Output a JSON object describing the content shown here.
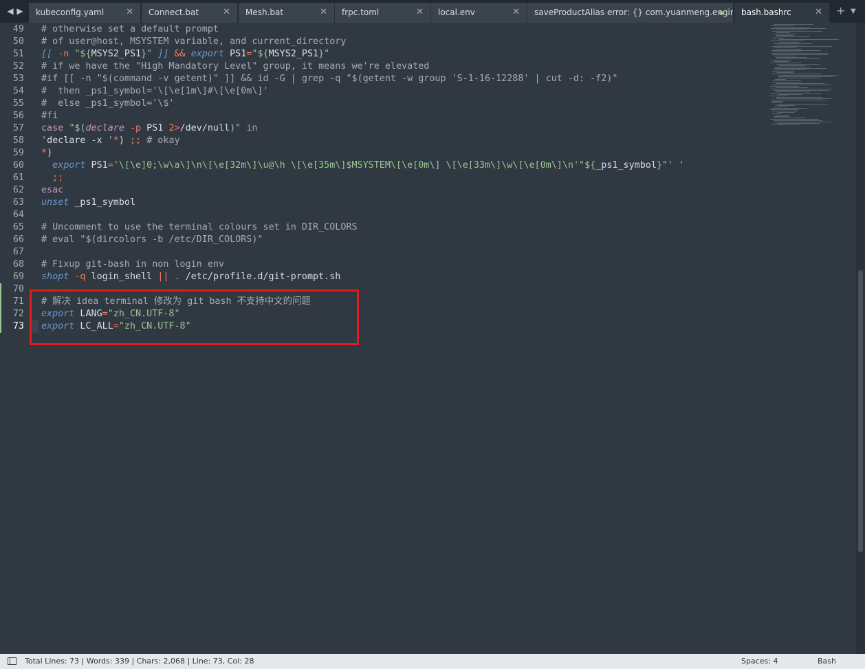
{
  "tabs": [
    {
      "label": "kubeconfig.yaml",
      "active": false
    },
    {
      "label": "Connect.bat",
      "active": false
    },
    {
      "label": "Mesh.bat",
      "active": false
    },
    {
      "label": "frpc.toml",
      "active": false
    },
    {
      "label": "local.env",
      "active": false
    },
    {
      "label": "saveProductAlias error: {} com.yuanmeng.engine.com",
      "active": false,
      "dirty": true
    },
    {
      "label": "bash.bashrc",
      "active": true
    }
  ],
  "icons": {
    "back": "◀",
    "forward": "▶",
    "close": "✕",
    "add": "+",
    "dropdown": "▼"
  },
  "lines": [
    {
      "n": "49",
      "parts": [
        [
          "c",
          "# otherwise set a default prompt"
        ]
      ]
    },
    {
      "n": "50",
      "parts": [
        [
          "c",
          "# of user@host, MSYSTEM variable, and current_directory"
        ]
      ]
    },
    {
      "n": "51",
      "parts": [
        [
          "k",
          "[["
        ],
        [
          "",
          " "
        ],
        [
          "o",
          "-n"
        ],
        [
          "",
          " "
        ],
        [
          "s",
          "\"${"
        ],
        [
          "",
          "MSYS2_PS1"
        ],
        [
          "s",
          "}\""
        ],
        [
          "",
          " "
        ],
        [
          "k",
          "]]"
        ],
        [
          "",
          " "
        ],
        [
          "o",
          "&&"
        ],
        [
          "",
          " "
        ],
        [
          "k",
          "export"
        ],
        [
          "",
          " PS1"
        ],
        [
          "o",
          "="
        ],
        [
          "s",
          "\"${"
        ],
        [
          "",
          "MSYS2_PS1"
        ],
        [
          "s",
          "}\""
        ]
      ]
    },
    {
      "n": "52",
      "parts": [
        [
          "c",
          "# if we have the \"High Mandatory Level\" group, it means we're elevated"
        ]
      ]
    },
    {
      "n": "53",
      "parts": [
        [
          "c",
          "#if [[ -n \"$(command -v getent)\" ]] && id -G | grep -q \"$(getent -w group 'S-1-16-12288' | cut -d: -f2)\""
        ]
      ]
    },
    {
      "n": "54",
      "parts": [
        [
          "c",
          "#  then _ps1_symbol='\\[\\e[1m\\]#\\[\\e[0m\\]'"
        ]
      ]
    },
    {
      "n": "55",
      "parts": [
        [
          "c",
          "#  else _ps1_symbol='\\$'"
        ]
      ]
    },
    {
      "n": "56",
      "parts": [
        [
          "c",
          "#fi"
        ]
      ]
    },
    {
      "n": "57",
      "parts": [
        [
          "kw",
          "case"
        ],
        [
          "",
          " "
        ],
        [
          "s",
          "\"$("
        ],
        [
          "dc",
          "declare"
        ],
        [
          "",
          " "
        ],
        [
          "o",
          "-p"
        ],
        [
          "",
          " PS1 "
        ],
        [
          "o",
          "2>"
        ],
        [
          "",
          "/dev/null"
        ],
        [
          "s",
          ")\""
        ],
        [
          "",
          " "
        ],
        [
          "kw",
          "in"
        ]
      ]
    },
    {
      "n": "58",
      "parts": [
        [
          "s",
          "'"
        ],
        [
          "",
          "declare -x "
        ],
        [
          "s",
          "'"
        ],
        [
          "o",
          "*"
        ],
        [
          "",
          ") "
        ],
        [
          "o",
          ";;"
        ],
        [
          "",
          " "
        ],
        [
          "c",
          "# okay"
        ]
      ]
    },
    {
      "n": "59",
      "parts": [
        [
          "o",
          "*"
        ],
        [
          "",
          ")"
        ]
      ]
    },
    {
      "n": "60",
      "parts": [
        [
          "",
          "  "
        ],
        [
          "k",
          "export"
        ],
        [
          "",
          " PS1"
        ],
        [
          "o",
          "="
        ],
        [
          "s",
          "'\\[\\e]0;\\w\\a\\]\\n\\[\\e[32m\\]\\u@\\h \\[\\e[35m\\]$MSYSTEM\\[\\e[0m\\] \\[\\e[33m\\]\\w\\[\\e[0m\\]\\n'"
        ],
        [
          "s",
          "\"${"
        ],
        [
          "",
          "_ps1_symbol"
        ],
        [
          "s",
          "}\"' '"
        ]
      ]
    },
    {
      "n": "61",
      "parts": [
        [
          "",
          "  "
        ],
        [
          "o",
          ";;"
        ]
      ]
    },
    {
      "n": "62",
      "parts": [
        [
          "kw",
          "esac"
        ]
      ]
    },
    {
      "n": "63",
      "parts": [
        [
          "k",
          "unset"
        ],
        [
          "",
          " _ps1_symbol"
        ]
      ]
    },
    {
      "n": "64",
      "parts": []
    },
    {
      "n": "65",
      "parts": [
        [
          "c",
          "# Uncomment to use the terminal colours set in DIR_COLORS"
        ]
      ]
    },
    {
      "n": "66",
      "parts": [
        [
          "c",
          "# eval \"$(dircolors -b /etc/DIR_COLORS)\""
        ]
      ]
    },
    {
      "n": "67",
      "parts": []
    },
    {
      "n": "68",
      "parts": [
        [
          "c",
          "# Fixup git-bash in non login env"
        ]
      ]
    },
    {
      "n": "69",
      "parts": [
        [
          "k",
          "shopt"
        ],
        [
          "",
          " "
        ],
        [
          "o",
          "-q"
        ],
        [
          "",
          " login_shell "
        ],
        [
          "o",
          "||"
        ],
        [
          "",
          " "
        ],
        [
          "o",
          "."
        ],
        [
          "",
          " /etc/profile.d/git-prompt.sh"
        ]
      ]
    },
    {
      "n": "70",
      "parts": [],
      "modified": true
    },
    {
      "n": "71",
      "parts": [
        [
          "c",
          "# 解决 idea terminal 修改为 git bash 不支持中文的问题"
        ]
      ],
      "modified": true
    },
    {
      "n": "72",
      "parts": [
        [
          "k",
          "export"
        ],
        [
          "",
          " LANG"
        ],
        [
          "o",
          "="
        ],
        [
          "s",
          "\"zh_CN.UTF-8\""
        ]
      ],
      "modified": true
    },
    {
      "n": "73",
      "parts": [
        [
          "k",
          "export"
        ],
        [
          "",
          " LC_ALL"
        ],
        [
          "o",
          "="
        ],
        [
          "s",
          "\"zh_CN.UTF-8\""
        ]
      ],
      "modified": true,
      "current": true
    }
  ],
  "statusbar": {
    "info": "Total Lines: 73 | Words: 339 | Chars: 2,068 | Line: 73, Col: 28",
    "spaces": "Spaces: 4",
    "syntax": "Bash"
  },
  "colors": {
    "background": "#303841",
    "tabbar": "#202830",
    "comment": "#a6acb3",
    "string": "#99c794",
    "keyword": "#6699cc",
    "operator": "#f97b58",
    "highlight_box": "#e41b1b"
  }
}
